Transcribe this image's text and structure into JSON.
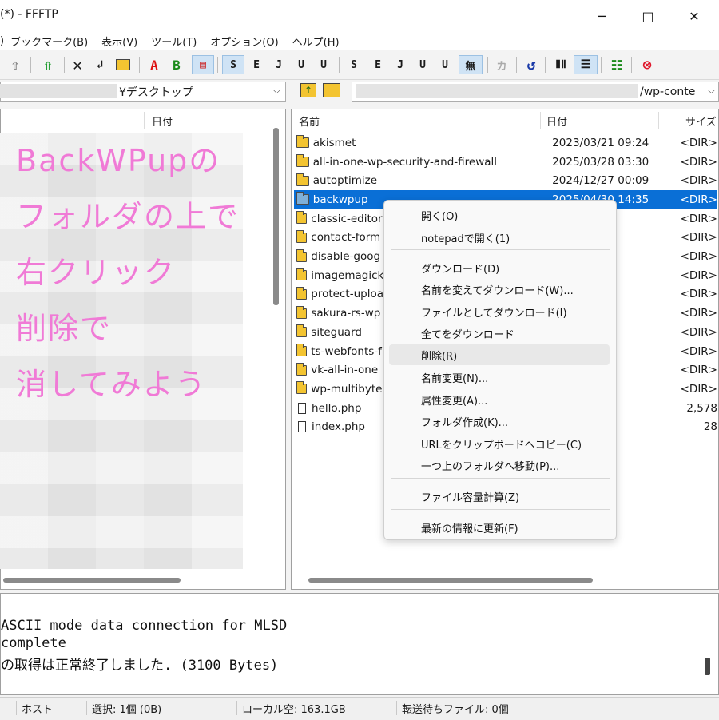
{
  "window": {
    "title": "(*) - FFFTP",
    "minimize_icon": "minimize-icon",
    "maximize_icon": "maximize-icon",
    "close_icon": "close-icon"
  },
  "menu": [
    "ブックマーク(B)",
    "表示(V)",
    "ツール(T)",
    "オプション(O)",
    "ヘルプ(H)"
  ],
  "menu_lead": ")",
  "toolbar": {
    "buttons": [
      "S",
      "E",
      "J",
      "U",
      "U",
      "S",
      "E",
      "J",
      "U",
      "U",
      "無",
      "カ"
    ],
    "icons": [
      "up-arrow-icon",
      "green-upload-icon",
      "delete-x-icon",
      "rename-icon",
      "new-folder-icon",
      "ascii-mode-icon",
      "binary-mode-icon",
      "auto-mode-icon",
      "refresh-icon",
      "list-view-icon",
      "detail-view-icon",
      "sync-icon",
      "stop-icon"
    ]
  },
  "local": {
    "path": "¥デスクトップ",
    "col_date": "日付"
  },
  "remote": {
    "path": "/wp-conte",
    "col_name": "名前",
    "col_date": "日付",
    "col_size": "サイズ",
    "files": [
      {
        "name": "akismet",
        "date": "2023/03/21 09:24",
        "size": "<DIR>",
        "type": "folder"
      },
      {
        "name": "all-in-one-wp-security-and-firewall",
        "date": "2025/03/28 03:30",
        "size": "<DIR>",
        "type": "folder"
      },
      {
        "name": "autoptimize",
        "date": "2024/12/27 00:09",
        "size": "<DIR>",
        "type": "folder"
      },
      {
        "name": "backwpup",
        "date": "2025/04/30 14:35",
        "size": "<DIR>",
        "type": "folder"
      },
      {
        "name": "classic-editor",
        "date": ":10",
        "size": "<DIR>",
        "type": "folder"
      },
      {
        "name": "contact-form",
        "date": ":49",
        "size": "<DIR>",
        "type": "folder"
      },
      {
        "name": "disable-goog",
        "date": ":18",
        "size": "<DIR>",
        "type": "folder"
      },
      {
        "name": "imagemagick",
        "date": ":01",
        "size": "<DIR>",
        "type": "folder"
      },
      {
        "name": "protect-uploa",
        "date": ":37",
        "size": "<DIR>",
        "type": "folder"
      },
      {
        "name": "sakura-rs-wp",
        "date": ":18",
        "size": "<DIR>",
        "type": "folder"
      },
      {
        "name": "siteguard",
        "date": ":23",
        "size": "<DIR>",
        "type": "folder"
      },
      {
        "name": "ts-webfonts-f",
        "date": ":56",
        "size": "<DIR>",
        "type": "folder"
      },
      {
        "name": "vk-all-in-one",
        "date": ":22",
        "size": "<DIR>",
        "type": "folder"
      },
      {
        "name": "wp-multibyte",
        "date": ":09",
        "size": "<DIR>",
        "type": "folder"
      },
      {
        "name": "hello.php",
        "date": ":19",
        "size": "2,578",
        "type": "file"
      },
      {
        "name": "index.php",
        "date": ":59",
        "size": "28",
        "type": "file"
      }
    ]
  },
  "context_menu": {
    "groups": [
      [
        "開く(O)",
        "notepadで開く(1)"
      ],
      [
        "ダウンロード(D)",
        "名前を変えてダウンロード(W)...",
        "ファイルとしてダウンロード(I)",
        "全てをダウンロード",
        "削除(R)",
        "名前変更(N)...",
        "属性変更(A)...",
        "フォルダ作成(K)...",
        "URLをクリップボードへコピー(C)",
        "一つ上のフォルダへ移動(P)..."
      ],
      [
        "ファイル容量計算(Z)"
      ],
      [
        "最新の情報に更新(F)"
      ]
    ],
    "hovered": "削除(R)"
  },
  "annotation": [
    "BackWPupの",
    "フォルダの上で",
    "右クリック",
    "削除で",
    "消してみよう"
  ],
  "log": [
    "ASCII mode data connection for MLSD",
    "complete",
    "の取得は正常終了しました. (3100 Bytes)"
  ],
  "status": {
    "host": "ホスト",
    "selection": "選択: 1個 (0B)",
    "local_free": "ローカル空: 163.1GB",
    "queue": "転送待ちファイル: 0個"
  }
}
